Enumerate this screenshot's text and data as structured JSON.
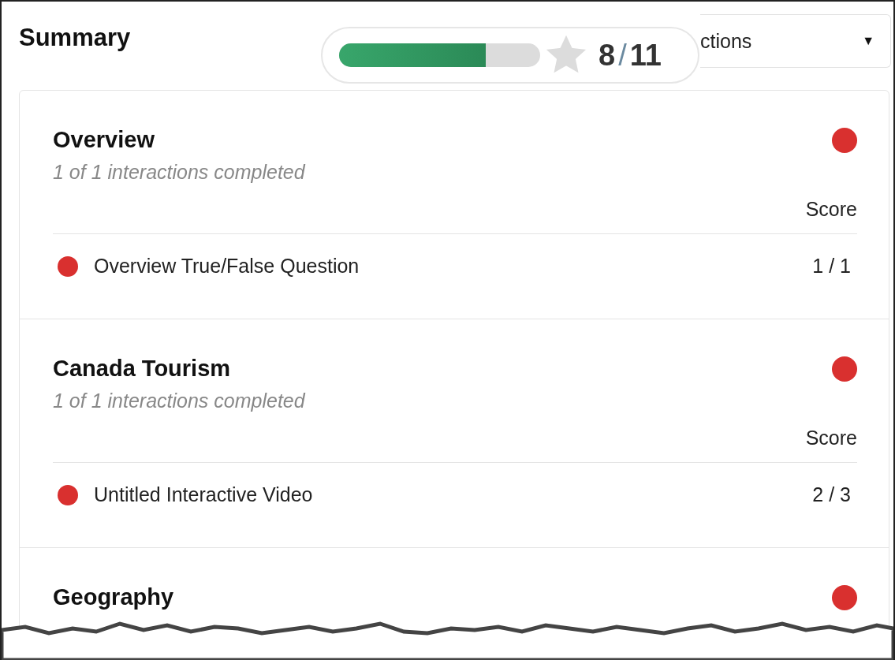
{
  "header": {
    "title": "Summary"
  },
  "score_pill": {
    "level": 0.73,
    "score": "8",
    "separator": "/",
    "total": "11"
  },
  "filter_dropdown": {
    "value": "ctions",
    "caret": "▼"
  },
  "sections": [
    {
      "title": "Overview",
      "subtitle": "1 of 1 interactions completed",
      "color": "#d9302f",
      "score_header": "Score",
      "items": [
        {
          "label": "Overview True/False Question",
          "score": "1 / 1",
          "color": "#d9302f"
        }
      ]
    },
    {
      "title": "Canada Tourism",
      "subtitle": "1 of 1 interactions completed",
      "color": "#d9302f",
      "score_header": "Score",
      "items": [
        {
          "label": "Untitled Interactive Video",
          "score": "2 / 3",
          "color": "#d9302f"
        }
      ]
    },
    {
      "title": "Geography",
      "color": "#d9302f"
    }
  ]
}
